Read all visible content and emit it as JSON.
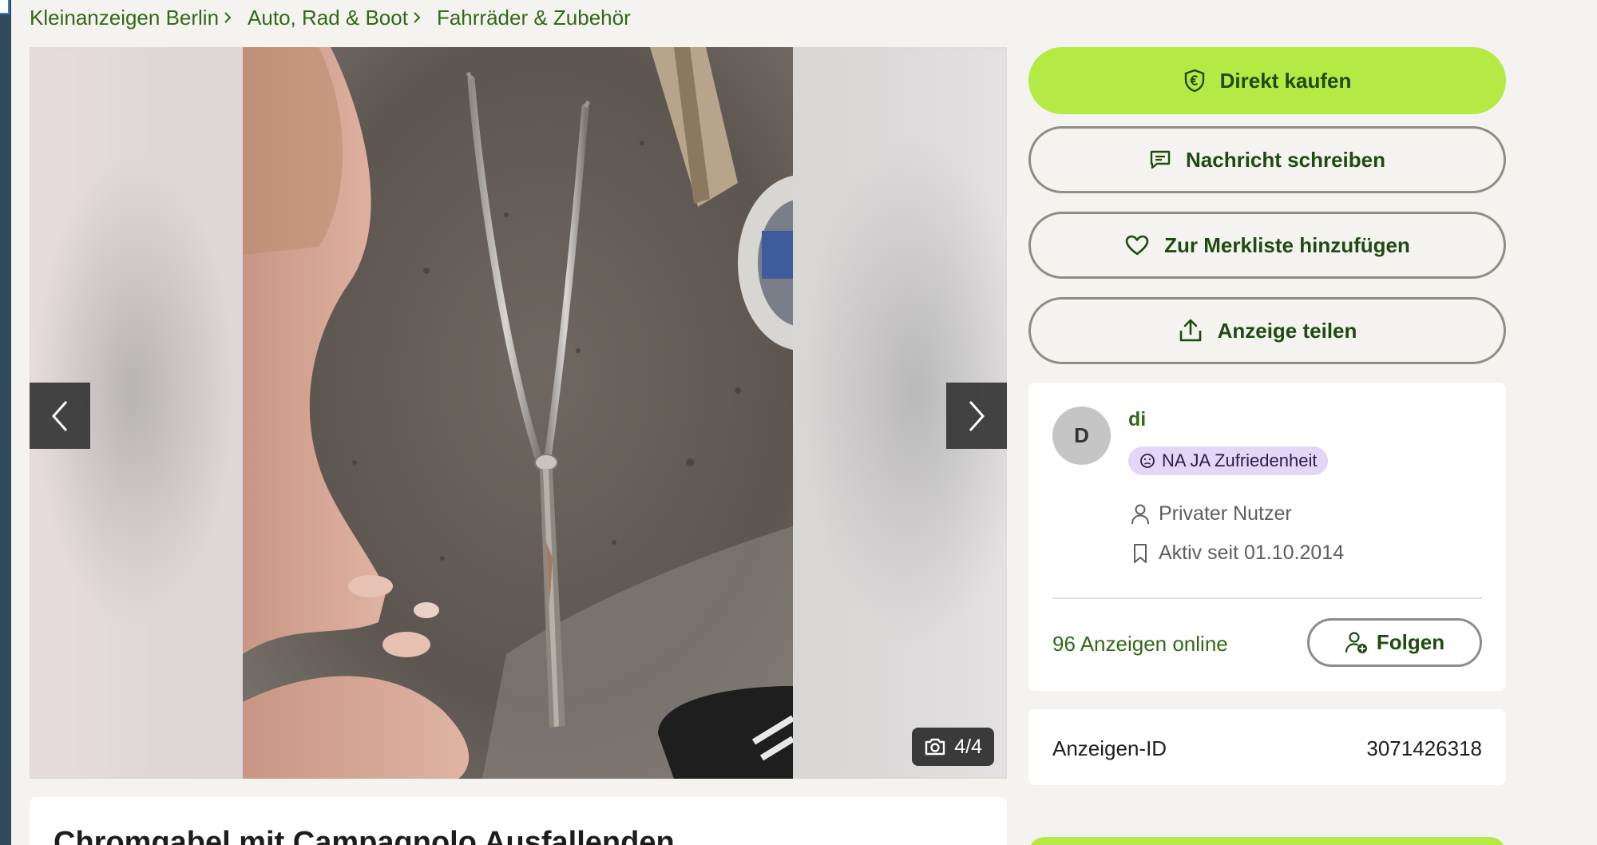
{
  "breadcrumb": {
    "items": [
      "Kleinanzeigen Berlin",
      "Auto, Rad & Boot",
      "Fahrräder & Zubehör"
    ]
  },
  "gallery": {
    "counter": "4/4",
    "current_image": 4,
    "total_images": 4
  },
  "listing": {
    "title": "Chromgabel mit Campagnolo Ausfallenden"
  },
  "actions": {
    "buy_label": "Direkt kaufen",
    "message_label": "Nachricht schreiben",
    "favorite_label": "Zur Merkliste hinzufügen",
    "share_label": "Anzeige teilen"
  },
  "seller": {
    "initial": "D",
    "name": "di",
    "rating_badge": "NA JA Zufriedenheit",
    "type": "Privater Nutzer",
    "active_since": "Aktiv seit 01.10.2014",
    "ads_online": "96 Anzeigen online",
    "follow_label": "Folgen"
  },
  "ad_id": {
    "label": "Anzeigen-ID",
    "value": "3071426318"
  },
  "colors": {
    "background": "#f4f3f0",
    "brand_green_text": "#326916",
    "primary_button": "#b5e944",
    "badge_purple": "#e3d6f7"
  }
}
